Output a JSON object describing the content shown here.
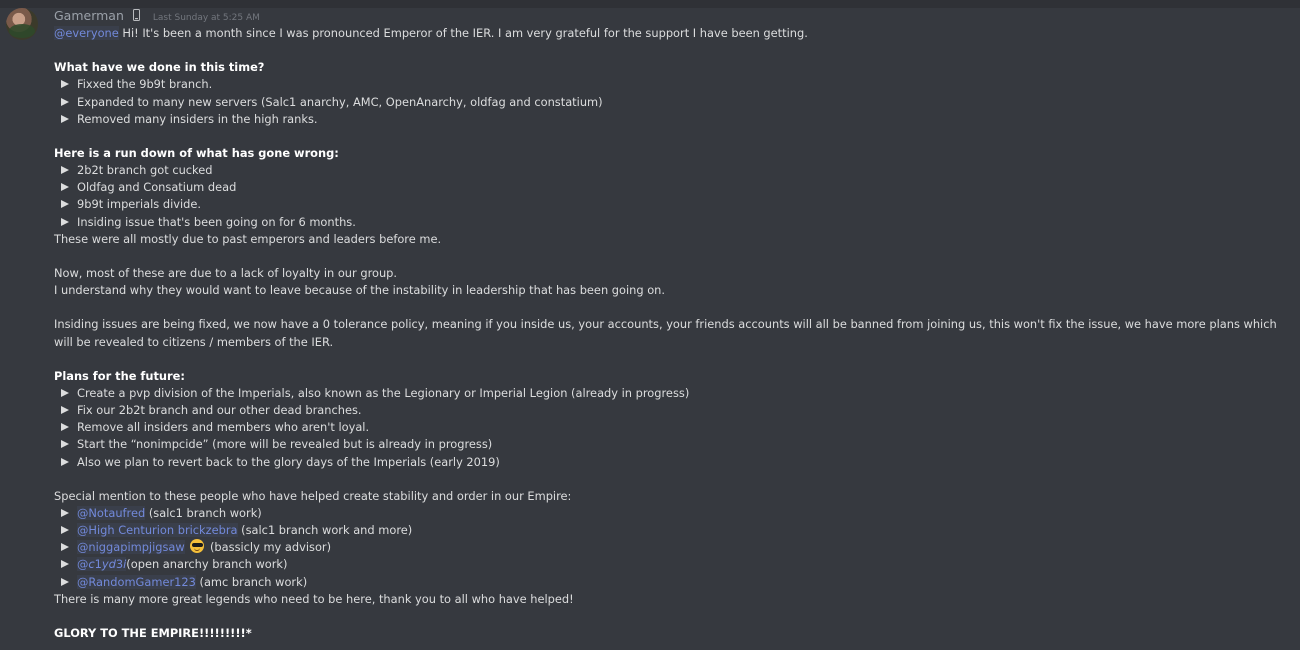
{
  "message": {
    "author": "Gamerman",
    "timestamp": "Last Sunday at 5:25 AM",
    "intro_mention": "@everyone",
    "intro_text": " Hi! It's been a month since I was pronounced Emperor of the IER. I am very grateful for the support I have been getting.",
    "done_heading": "What have we done in this time?",
    "done_items": [
      "Fixxed the 9b9t branch.",
      "Expanded to many new servers (Salc1 anarchy, AMC, OpenAnarchy, oldfag and constatium)",
      "Removed many insiders in the high ranks."
    ],
    "wrong_heading": "Here is a run down of what has gone wrong:",
    "wrong_items": [
      "2b2t branch got cucked",
      "Oldfag and Consatium dead",
      "9b9t imperials divide.",
      "Insiding issue that's been going on for 6 months."
    ],
    "wrong_note": "These were all mostly due to past emperors and leaders before me.",
    "para1_line1": "Now, most of these are due to a lack of loyalty in our group.",
    "para1_line2": "I understand why they would want to leave because of the instability in leadership that has been going on.",
    "para2": "Insiding issues are being fixed, we now have a 0 tolerance policy, meaning if you inside us, your accounts, your friends accounts will all be banned from joining us, this won't fix the issue, we have more plans which will be revealed to citizens / members of the IER.",
    "plans_heading": "Plans for the future:",
    "plans_items": [
      "Create a pvp division of the Imperials, also known as the Legionary or Imperial Legion (already in progress)",
      "Fix our 2b2t branch and our other dead branches.",
      "Remove all insiders and members who aren't loyal.",
      "Start the “nonimpcide” (more will be revealed but is already in progress)",
      "Also we plan to revert back to the glory days of the Imperials (early 2019)"
    ],
    "special_intro": "Special mention to these people who have helped create stability and order in our Empire:",
    "special_items": [
      {
        "mention": "@Notaufred",
        "text": " (salc1 branch work)"
      },
      {
        "mention": "@High Centurion brickzebra",
        "text": " (salc1 branch work and more)"
      },
      {
        "mention": "@niggapimpjigsaw",
        "emoji": "sunglasses-emoji",
        "text": " (bassicly my advisor)"
      },
      {
        "mention": "@𝘤1𝘺𝘥3𝘪",
        "text": "(open anarchy branch work)"
      },
      {
        "mention": "@RandomGamer123",
        "text": " (amc branch work)"
      }
    ],
    "closing_line": "There is many more great legends who need to be here, thank you to all who have helped!",
    "glory": "GLORY TO THE EMPIRE!!!!!!!!!*"
  },
  "colors": {
    "background": "#36393f",
    "text": "#dcddde",
    "mention": "#7289da",
    "timestamp": "#72767d"
  }
}
